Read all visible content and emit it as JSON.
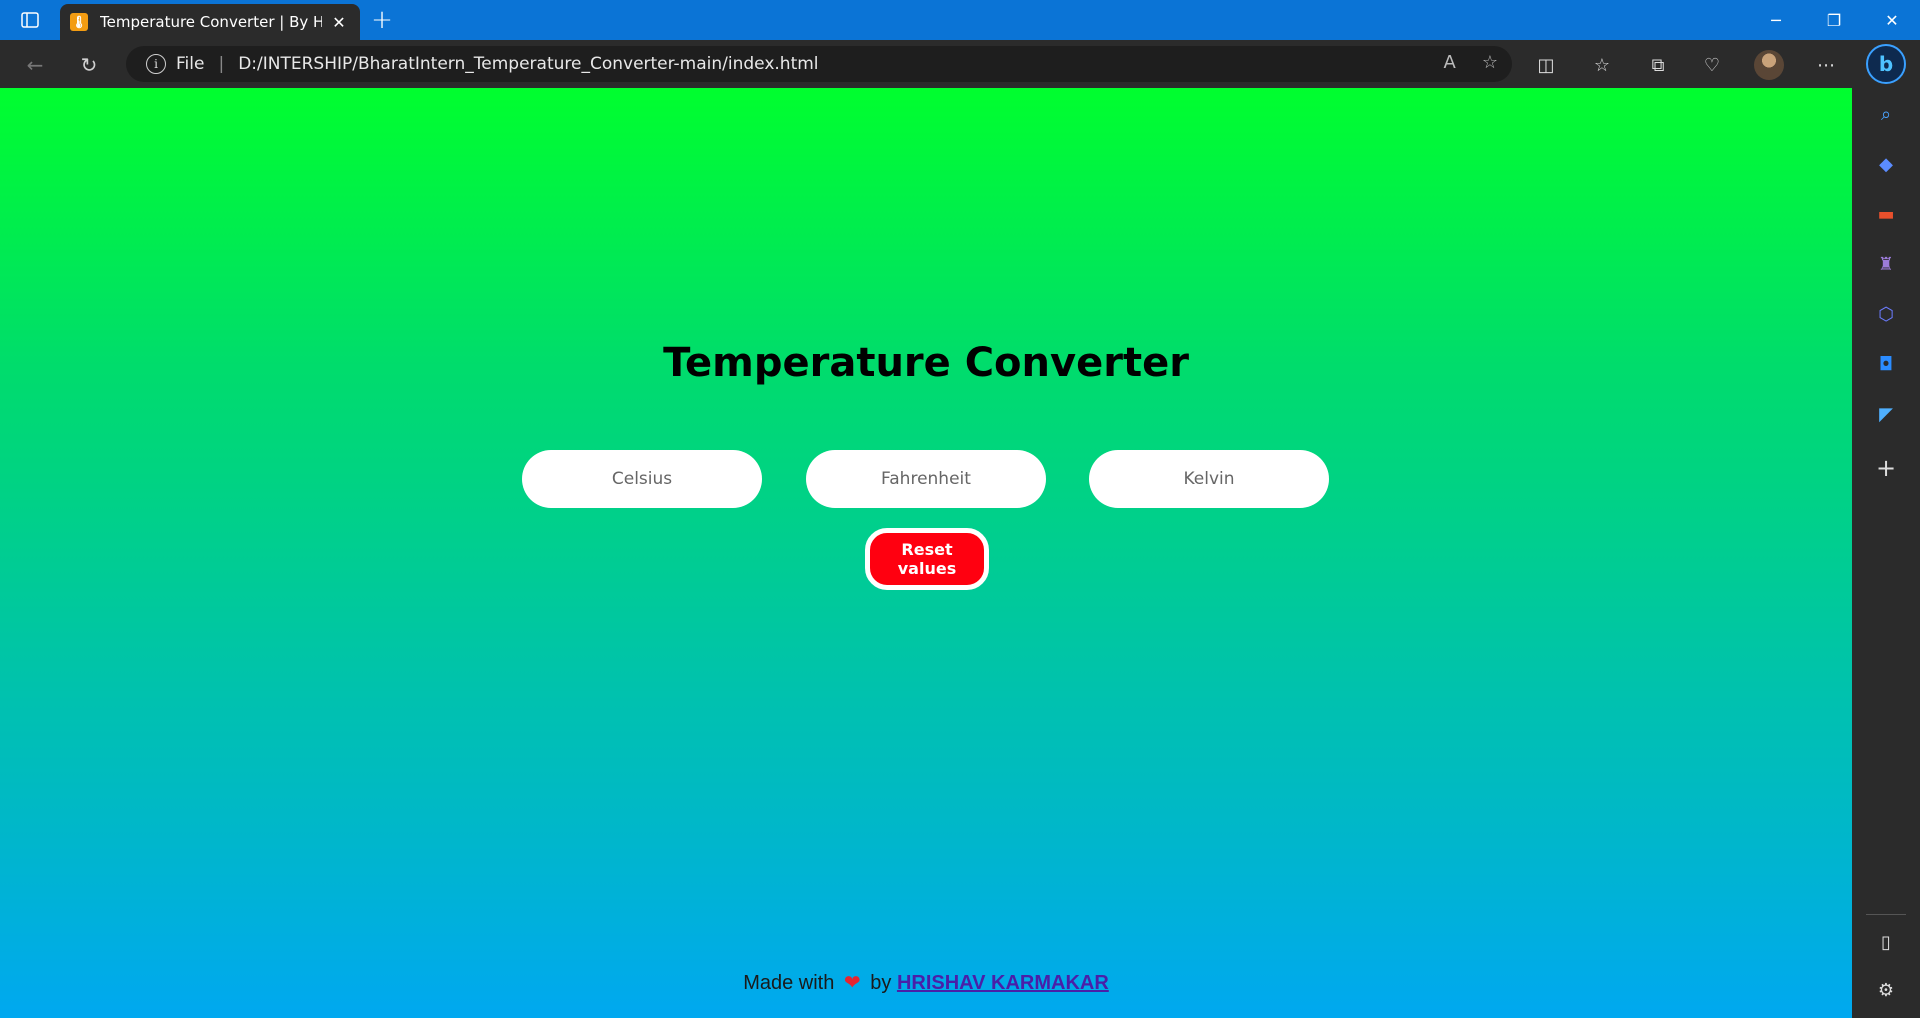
{
  "browser": {
    "tab": {
      "title": "Temperature Converter | By HRISHAV KARMAKAR",
      "favicon": "thermometer-icon"
    },
    "window_controls": {
      "minimize": "─",
      "restore": "❐",
      "close": "✕"
    },
    "address_bar": {
      "scheme": "File",
      "url": "D:/INTERSHIP/BharatIntern_Temperature_Converter-main/index.html"
    },
    "accent_color": "#0b74d6"
  },
  "page": {
    "heading": "Temperature Converter",
    "inputs": [
      {
        "placeholder": "Celsius"
      },
      {
        "placeholder": "Fahrenheit"
      },
      {
        "placeholder": "Kelvin"
      }
    ],
    "reset_button": "Reset values",
    "footer": {
      "prefix": "Made with",
      "heart": "❤",
      "by": "by",
      "author": "HRISHAV KARMAKAR"
    },
    "colors": {
      "gradient_top": "#00ff2e",
      "gradient_bottom": "#00a8f0",
      "reset_button": "#ff0010"
    }
  }
}
